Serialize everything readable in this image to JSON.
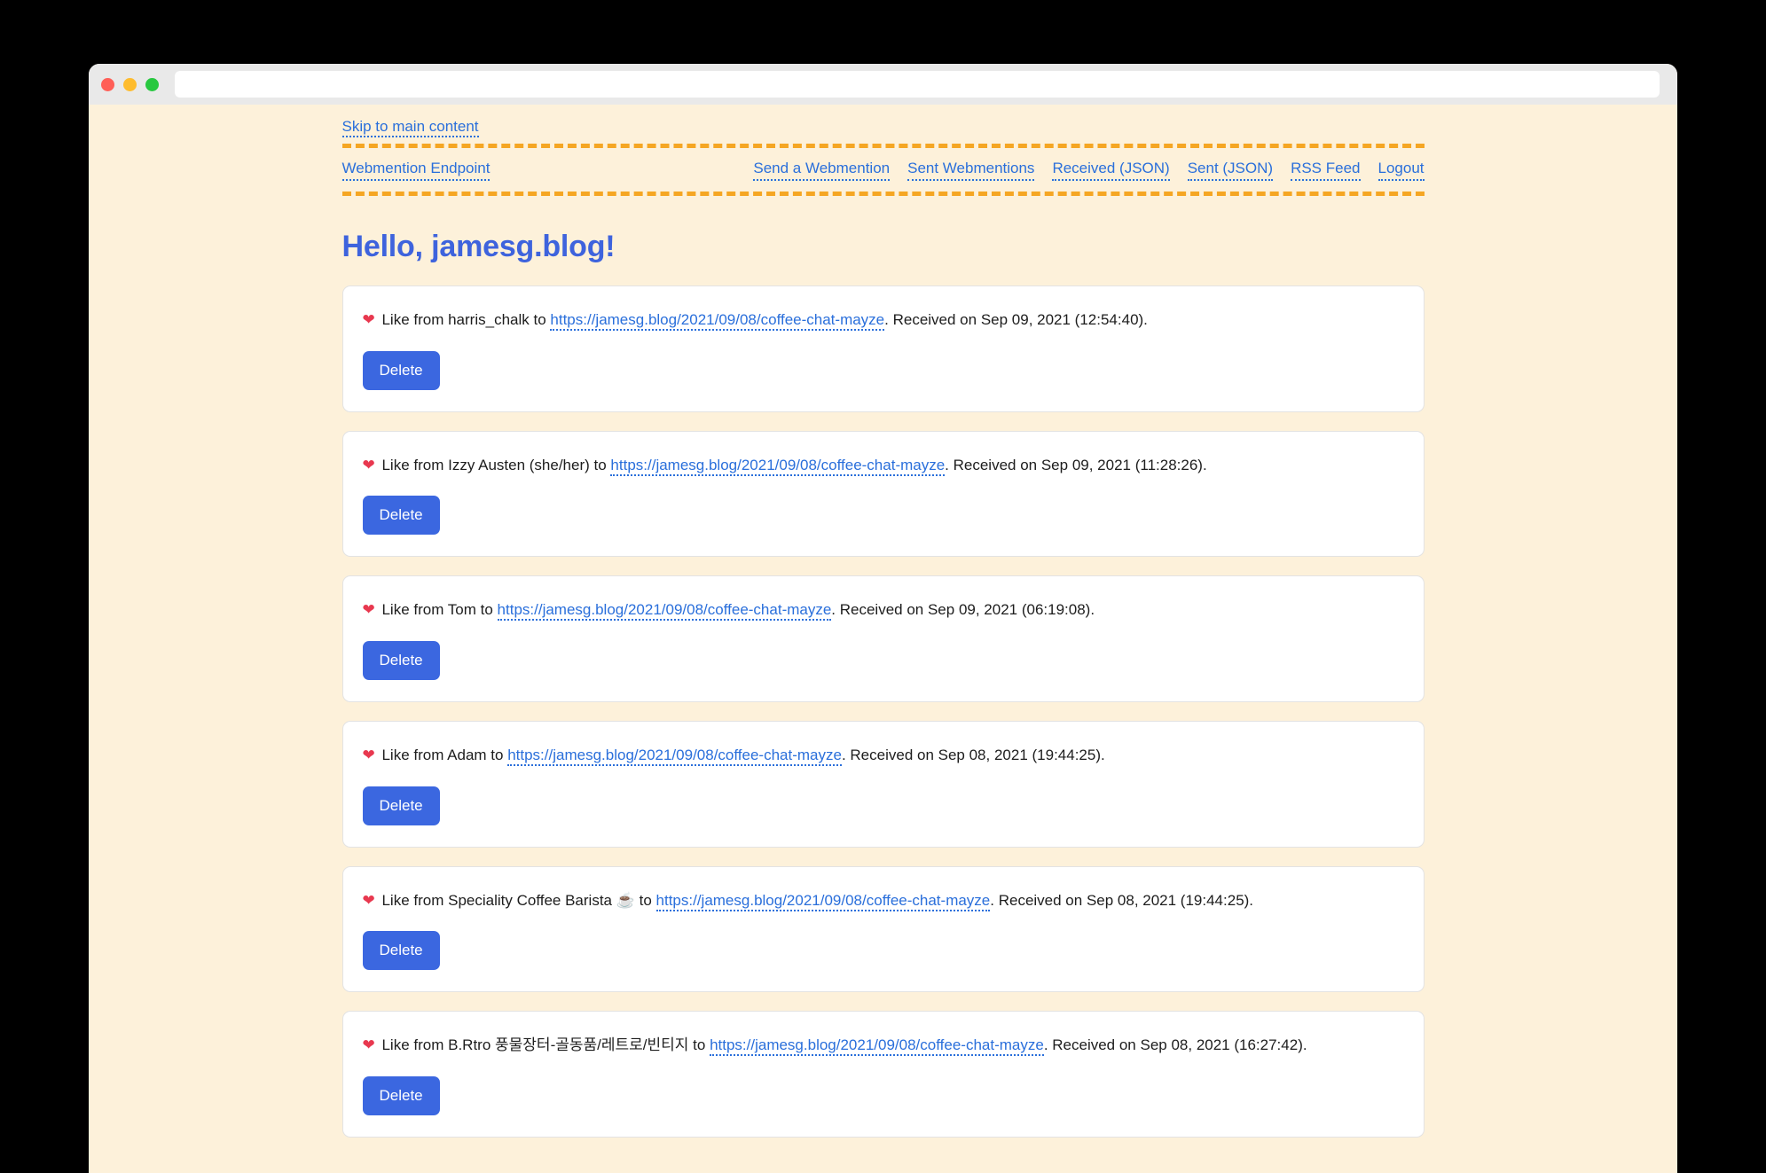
{
  "browser": {
    "url_value": "",
    "url_placeholder": "",
    "traffic_lights": [
      "close-button",
      "minimize-button",
      "maximize-button"
    ]
  },
  "skip_link": "Skip to main content",
  "nav": {
    "brand": "Webmention Endpoint",
    "links": [
      "Send a Webmention",
      "Sent Webmentions",
      "Received (JSON)",
      "Sent (JSON)",
      "RSS Feed",
      "Logout"
    ]
  },
  "page_title": "Hello, jamesg.blog!",
  "colors": {
    "page_background": "#fdf1da",
    "link": "#2a6fdb",
    "heading": "#3e63dd",
    "dashed_border": "#f5a623",
    "button": "#3b67e0",
    "heart": "#e8384f",
    "card_background": "#ffffff"
  },
  "delete_label": "Delete",
  "mentions": [
    {
      "icon": "❤",
      "prefix": "Like from harris_chalk to",
      "url": "https://jamesg.blog/2021/09/08/coffee-chat-mayze",
      "suffix": ". Received on Sep 09, 2021 (12:54:40)."
    },
    {
      "icon": "❤",
      "prefix": "Like from Izzy Austen (she/her) to",
      "url": "https://jamesg.blog/2021/09/08/coffee-chat-mayze",
      "suffix": ". Received on Sep 09, 2021 (11:28:26)."
    },
    {
      "icon": "❤",
      "prefix": "Like from Tom to",
      "url": "https://jamesg.blog/2021/09/08/coffee-chat-mayze",
      "suffix": ". Received on Sep 09, 2021 (06:19:08)."
    },
    {
      "icon": "❤",
      "prefix": "Like from Adam to",
      "url": "https://jamesg.blog/2021/09/08/coffee-chat-mayze",
      "suffix": ". Received on Sep 08, 2021 (19:44:25)."
    },
    {
      "icon": "❤",
      "prefix": "Like from Speciality Coffee Barista ☕ to",
      "url": "https://jamesg.blog/2021/09/08/coffee-chat-mayze",
      "suffix": ". Received on Sep 08, 2021 (19:44:25)."
    },
    {
      "icon": "❤",
      "prefix": "Like from B.Rtro 풍물장터-골동품/레트로/빈티지 to",
      "url": "https://jamesg.blog/2021/09/08/coffee-chat-mayze",
      "suffix": ". Received on Sep 08, 2021 (16:27:42)."
    }
  ]
}
